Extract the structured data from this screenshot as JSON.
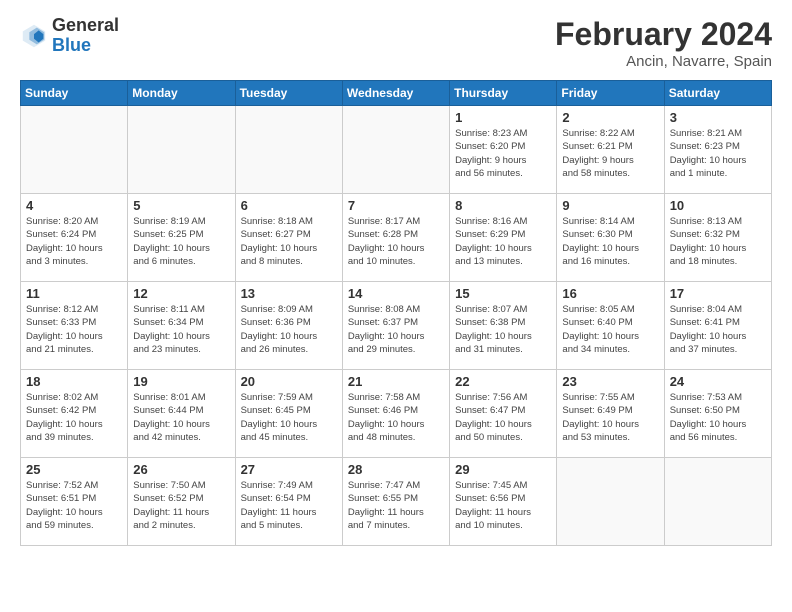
{
  "logo": {
    "general": "General",
    "blue": "Blue"
  },
  "title": {
    "month_year": "February 2024",
    "location": "Ancin, Navarre, Spain"
  },
  "weekdays": [
    "Sunday",
    "Monday",
    "Tuesday",
    "Wednesday",
    "Thursday",
    "Friday",
    "Saturday"
  ],
  "weeks": [
    [
      {
        "day": "",
        "info": ""
      },
      {
        "day": "",
        "info": ""
      },
      {
        "day": "",
        "info": ""
      },
      {
        "day": "",
        "info": ""
      },
      {
        "day": "1",
        "info": "Sunrise: 8:23 AM\nSunset: 6:20 PM\nDaylight: 9 hours\nand 56 minutes."
      },
      {
        "day": "2",
        "info": "Sunrise: 8:22 AM\nSunset: 6:21 PM\nDaylight: 9 hours\nand 58 minutes."
      },
      {
        "day": "3",
        "info": "Sunrise: 8:21 AM\nSunset: 6:23 PM\nDaylight: 10 hours\nand 1 minute."
      }
    ],
    [
      {
        "day": "4",
        "info": "Sunrise: 8:20 AM\nSunset: 6:24 PM\nDaylight: 10 hours\nand 3 minutes."
      },
      {
        "day": "5",
        "info": "Sunrise: 8:19 AM\nSunset: 6:25 PM\nDaylight: 10 hours\nand 6 minutes."
      },
      {
        "day": "6",
        "info": "Sunrise: 8:18 AM\nSunset: 6:27 PM\nDaylight: 10 hours\nand 8 minutes."
      },
      {
        "day": "7",
        "info": "Sunrise: 8:17 AM\nSunset: 6:28 PM\nDaylight: 10 hours\nand 10 minutes."
      },
      {
        "day": "8",
        "info": "Sunrise: 8:16 AM\nSunset: 6:29 PM\nDaylight: 10 hours\nand 13 minutes."
      },
      {
        "day": "9",
        "info": "Sunrise: 8:14 AM\nSunset: 6:30 PM\nDaylight: 10 hours\nand 16 minutes."
      },
      {
        "day": "10",
        "info": "Sunrise: 8:13 AM\nSunset: 6:32 PM\nDaylight: 10 hours\nand 18 minutes."
      }
    ],
    [
      {
        "day": "11",
        "info": "Sunrise: 8:12 AM\nSunset: 6:33 PM\nDaylight: 10 hours\nand 21 minutes."
      },
      {
        "day": "12",
        "info": "Sunrise: 8:11 AM\nSunset: 6:34 PM\nDaylight: 10 hours\nand 23 minutes."
      },
      {
        "day": "13",
        "info": "Sunrise: 8:09 AM\nSunset: 6:36 PM\nDaylight: 10 hours\nand 26 minutes."
      },
      {
        "day": "14",
        "info": "Sunrise: 8:08 AM\nSunset: 6:37 PM\nDaylight: 10 hours\nand 29 minutes."
      },
      {
        "day": "15",
        "info": "Sunrise: 8:07 AM\nSunset: 6:38 PM\nDaylight: 10 hours\nand 31 minutes."
      },
      {
        "day": "16",
        "info": "Sunrise: 8:05 AM\nSunset: 6:40 PM\nDaylight: 10 hours\nand 34 minutes."
      },
      {
        "day": "17",
        "info": "Sunrise: 8:04 AM\nSunset: 6:41 PM\nDaylight: 10 hours\nand 37 minutes."
      }
    ],
    [
      {
        "day": "18",
        "info": "Sunrise: 8:02 AM\nSunset: 6:42 PM\nDaylight: 10 hours\nand 39 minutes."
      },
      {
        "day": "19",
        "info": "Sunrise: 8:01 AM\nSunset: 6:44 PM\nDaylight: 10 hours\nand 42 minutes."
      },
      {
        "day": "20",
        "info": "Sunrise: 7:59 AM\nSunset: 6:45 PM\nDaylight: 10 hours\nand 45 minutes."
      },
      {
        "day": "21",
        "info": "Sunrise: 7:58 AM\nSunset: 6:46 PM\nDaylight: 10 hours\nand 48 minutes."
      },
      {
        "day": "22",
        "info": "Sunrise: 7:56 AM\nSunset: 6:47 PM\nDaylight: 10 hours\nand 50 minutes."
      },
      {
        "day": "23",
        "info": "Sunrise: 7:55 AM\nSunset: 6:49 PM\nDaylight: 10 hours\nand 53 minutes."
      },
      {
        "day": "24",
        "info": "Sunrise: 7:53 AM\nSunset: 6:50 PM\nDaylight: 10 hours\nand 56 minutes."
      }
    ],
    [
      {
        "day": "25",
        "info": "Sunrise: 7:52 AM\nSunset: 6:51 PM\nDaylight: 10 hours\nand 59 minutes."
      },
      {
        "day": "26",
        "info": "Sunrise: 7:50 AM\nSunset: 6:52 PM\nDaylight: 11 hours\nand 2 minutes."
      },
      {
        "day": "27",
        "info": "Sunrise: 7:49 AM\nSunset: 6:54 PM\nDaylight: 11 hours\nand 5 minutes."
      },
      {
        "day": "28",
        "info": "Sunrise: 7:47 AM\nSunset: 6:55 PM\nDaylight: 11 hours\nand 7 minutes."
      },
      {
        "day": "29",
        "info": "Sunrise: 7:45 AM\nSunset: 6:56 PM\nDaylight: 11 hours\nand 10 minutes."
      },
      {
        "day": "",
        "info": ""
      },
      {
        "day": "",
        "info": ""
      }
    ]
  ]
}
